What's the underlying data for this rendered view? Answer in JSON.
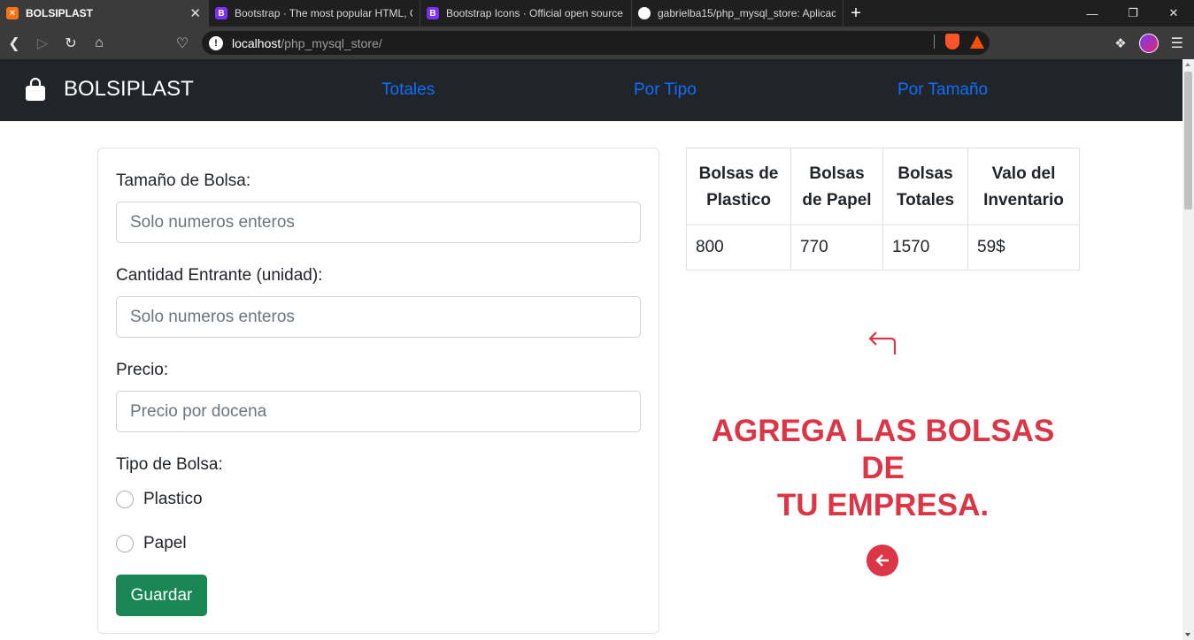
{
  "browser": {
    "tabs": [
      {
        "title": "BOLSIPLAST",
        "favicon": "xampp-icon",
        "active": true
      },
      {
        "title": "Bootstrap · The most popular HTML, C",
        "favicon": "bootstrap-icon",
        "active": false
      },
      {
        "title": "Bootstrap Icons · Official open source",
        "favicon": "bootstrap-icon",
        "active": false
      },
      {
        "title": "gabrielba15/php_mysql_store: Aplicac",
        "favicon": "github-icon",
        "active": false
      }
    ],
    "url_host": "localhost",
    "url_path": "/php_mysql_store/"
  },
  "navbar": {
    "brand": "BOLSIPLAST",
    "brand_icon": "bag-icon",
    "links": [
      "Totales",
      "Por Tipo",
      "Por Tamaño"
    ],
    "link_color": "#0d6efd"
  },
  "form": {
    "size": {
      "label": "Tamaño de Bolsa:",
      "placeholder": "Solo numeros enteros",
      "value": ""
    },
    "quantity": {
      "label": "Cantidad Entrante (unidad):",
      "placeholder": "Solo numeros enteros",
      "value": ""
    },
    "price": {
      "label": "Precio:",
      "placeholder": "Precio por docena",
      "value": ""
    },
    "type": {
      "label": "Tipo de Bolsa:",
      "options": [
        "Plastico",
        "Papel"
      ],
      "selected": null
    },
    "submit_label": "Guardar",
    "submit_color": "#198754"
  },
  "inventory": {
    "headers": [
      [
        "Bolsas",
        "de",
        "Plastico"
      ],
      [
        "Bolsas",
        "de Papel"
      ],
      [
        "Bolsas",
        "Totales"
      ],
      [
        "Valo del",
        "Inventario"
      ]
    ],
    "row": [
      "800",
      "770",
      "1570",
      "59$"
    ]
  },
  "promo": {
    "headline_line1": "AGREGA LAS BOLSAS DE",
    "headline_line2": "TU EMPRESA.",
    "color": "#dc3545",
    "top_icon": "arrow-return-left-icon",
    "bottom_icon": "arrow-left-circle-icon"
  }
}
